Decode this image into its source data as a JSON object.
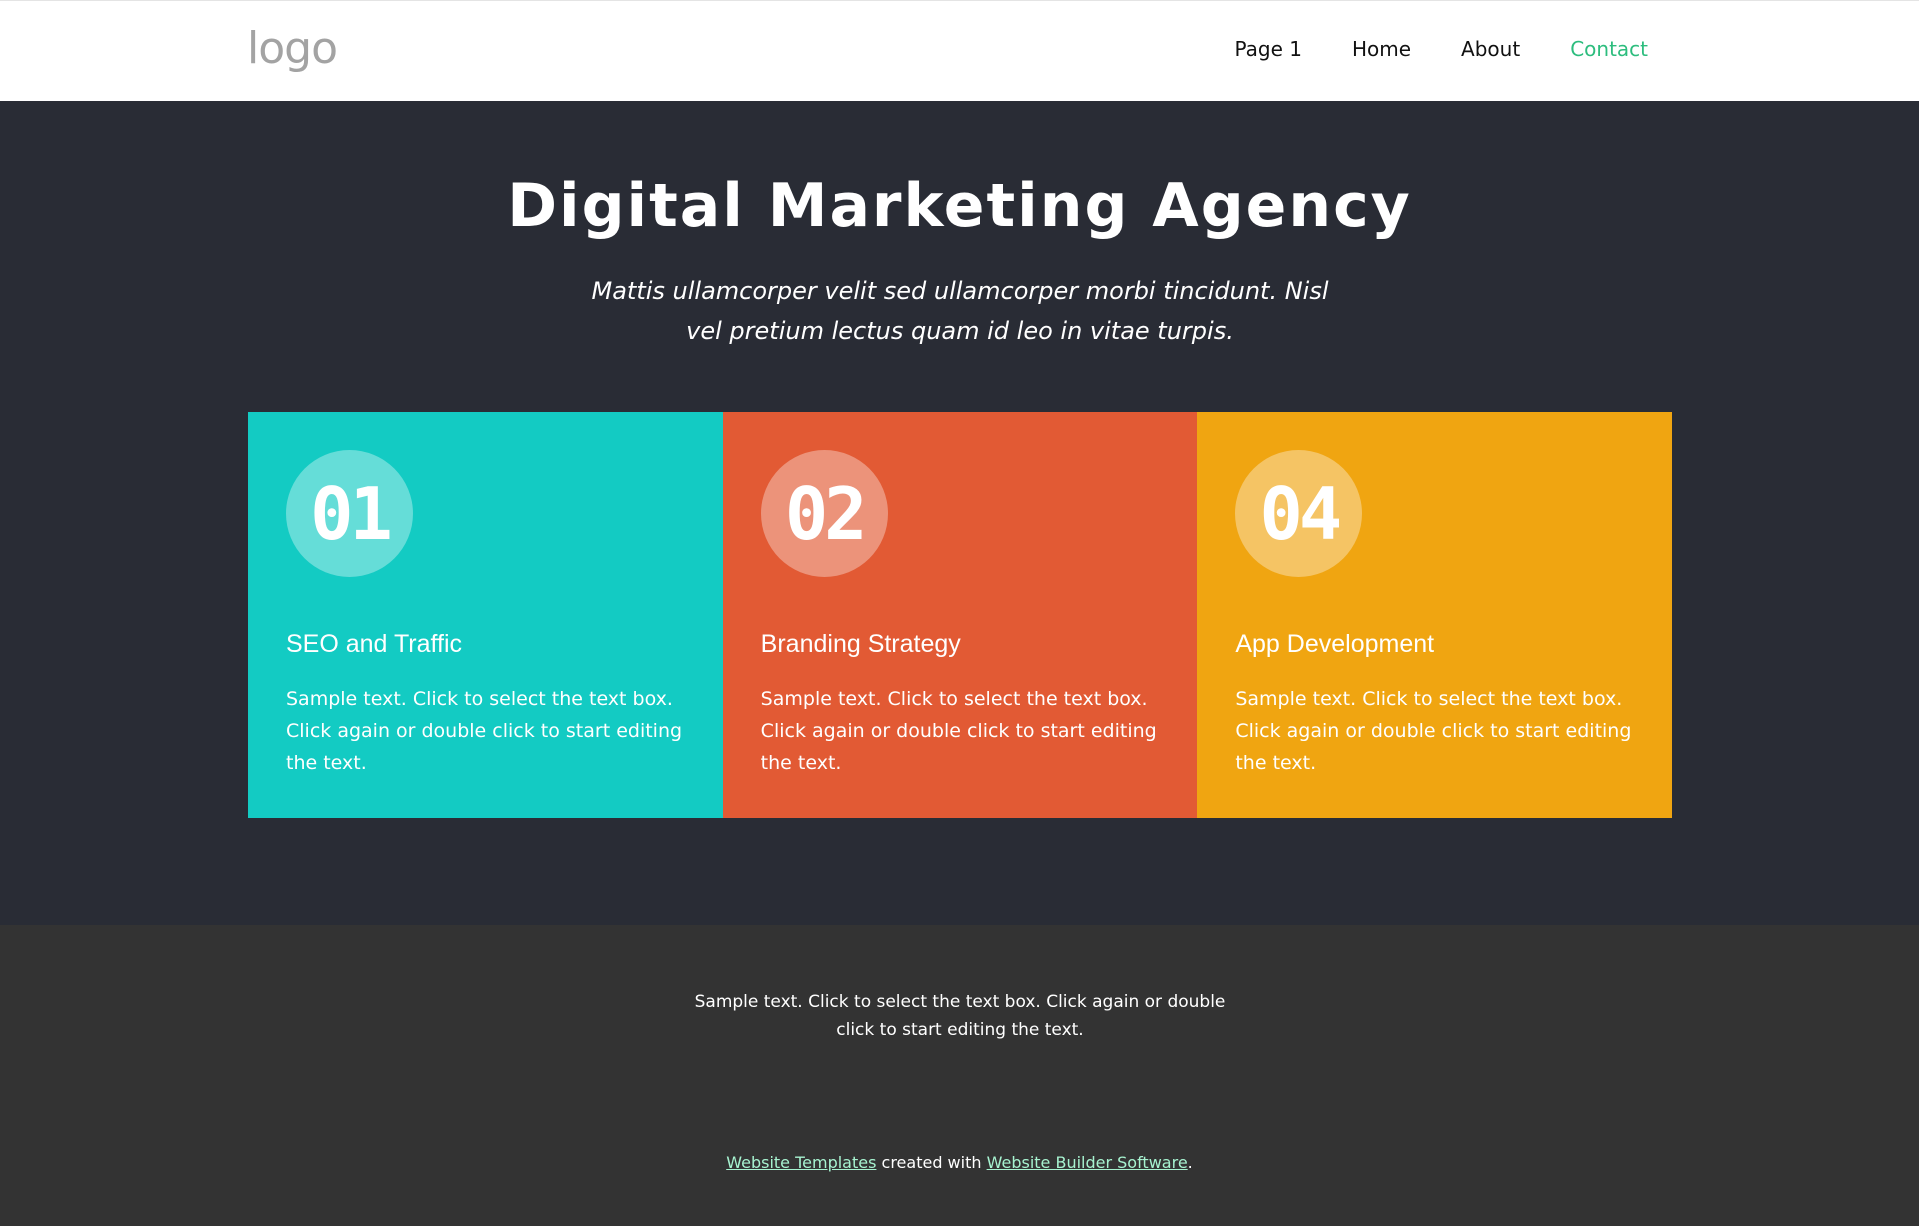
{
  "header": {
    "logo_text": "logo",
    "nav": [
      {
        "label": "Page 1",
        "active": false
      },
      {
        "label": "Home",
        "active": false
      },
      {
        "label": "About",
        "active": false
      },
      {
        "label": "Contact",
        "active": true
      }
    ]
  },
  "hero": {
    "title": "Digital Marketing Agency",
    "subtitle": "Mattis ullamcorper velit sed ullamcorper morbi tincidunt. Nisl vel pretium lectus quam id leo in vitae turpis."
  },
  "cards": [
    {
      "number": "01",
      "title": "SEO and Traffic",
      "text": "Sample text. Click to select the text box. Click again or double click to start editing the text.",
      "color": "#13cbc3"
    },
    {
      "number": "02",
      "title": "Branding Strategy",
      "text": "Sample text. Click to select the text box. Click again or double click to start editing the text.",
      "color": "#e25a34"
    },
    {
      "number": "04",
      "title": "App Development",
      "text": "Sample text. Click to select the text box. Click again or double click to start editing the text.",
      "color": "#f0a511"
    }
  ],
  "footer": {
    "text": "Sample text. Click to select the text box. Click again or double click to start editing the text.",
    "credit_link_1": "Website Templates",
    "credit_middle": " created with ",
    "credit_link_2": "Website Builder Software",
    "credit_end": "."
  },
  "colors": {
    "hero_bg": "#292c35",
    "footer_bg": "#333333",
    "nav_active": "#2dbd7e",
    "link": "#a7f3d0"
  }
}
